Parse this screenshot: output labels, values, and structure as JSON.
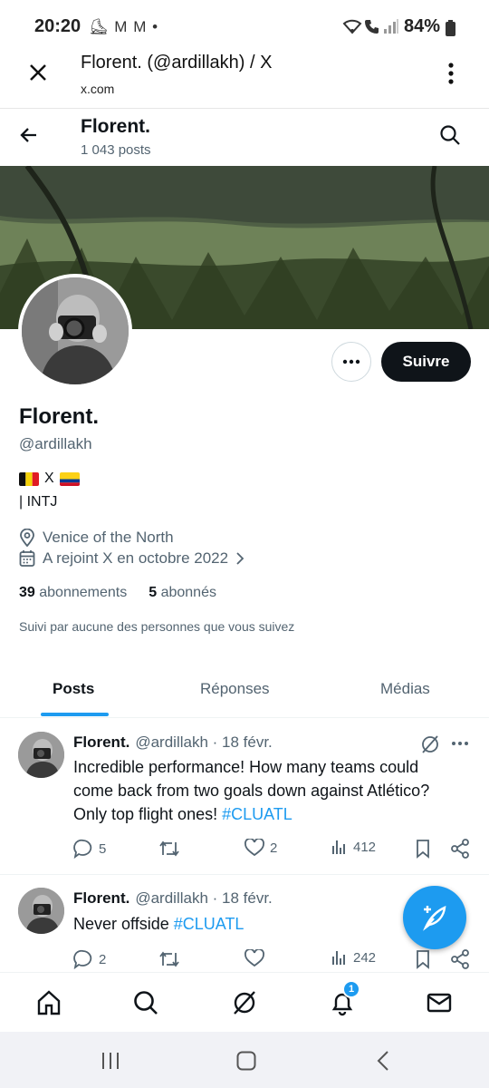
{
  "status_bar": {
    "time": "20:20",
    "left_icons": "⛸ M M •",
    "battery": "84%"
  },
  "browser": {
    "title": "Florent. (@ardillakh) / X",
    "url": "x.com"
  },
  "profile_header": {
    "name": "Florent.",
    "posts_count": "1 043 posts"
  },
  "profile": {
    "name": "Florent.",
    "handle": "@ardillakh",
    "bio_line1_mid": "X",
    "bio_line2": "| INTJ",
    "location": "Venice of the North",
    "joined": "A rejoint X en octobre 2022",
    "following_count": "39",
    "following_label": "abonnements",
    "followers_count": "5",
    "followers_label": "abonnés",
    "followed_by": "Suivi par aucune des personnes que vous suivez",
    "follow_button": "Suivre"
  },
  "tabs": [
    {
      "label": "Posts",
      "active": true
    },
    {
      "label": "Réponses",
      "active": false
    },
    {
      "label": "Médias",
      "active": false
    }
  ],
  "tweets": [
    {
      "name": "Florent.",
      "meta": "@ardillakh · 18 févr.",
      "text": "Incredible performance! How many teams could come back from two goals down against Atlético? Only top flight ones!",
      "hashtag": "#CLUATL",
      "replies": "5",
      "retweets": "",
      "likes": "2",
      "views": "412"
    },
    {
      "name": "Florent.",
      "meta": "@ardillakh · 18 févr.",
      "text": "Never offside",
      "hashtag": "#CLUATL",
      "replies": "2",
      "retweets": "",
      "likes": "",
      "views": "242"
    }
  ],
  "bottom_nav": {
    "notifications_badge": "1"
  },
  "colors": {
    "accent": "#1d9bf0",
    "text": "#0f1419",
    "secondary": "#536471"
  }
}
